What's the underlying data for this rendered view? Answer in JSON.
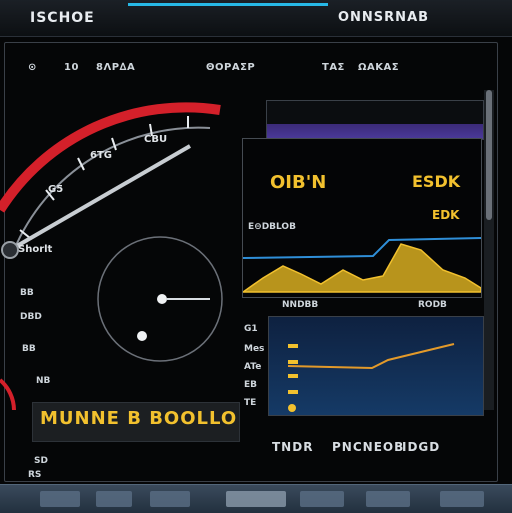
{
  "window": {
    "title": "ISCHOE",
    "title_right": "ONNSRNAB"
  },
  "header": {
    "items": [
      "⊙",
      "10 ",
      "8ΛΡ∆Α",
      "ΘΟΡΑΣΡ",
      "ΤΑΣ",
      "ΩΑΚΑΣ"
    ]
  },
  "speedometer": {
    "label_top": "CBU",
    "label_mid": "6TG",
    "label_left": "Shorlt",
    "label_lower": "G5",
    "side_labels": [
      "BB",
      "DBD",
      "BB",
      "NB",
      "SD",
      "RS"
    ]
  },
  "lcd": {
    "text": "MUNNE B BOOLLO"
  },
  "panels": {
    "top": {
      "big_left": "OIB'N",
      "big_right": "ESDK",
      "sub_right": "EDK",
      "label": "E⊖DBLOB"
    },
    "bottom": {
      "header_left": "NNDBB",
      "header_right": "RODB",
      "footer": [
        "TNDR",
        "PNCNEOB",
        "IDGD"
      ]
    },
    "side_labels": [
      "G1",
      "Mes",
      "ATe",
      "EB",
      "TE"
    ]
  },
  "taskbar": {
    "items": [
      "",
      "",
      "",
      "",
      "",
      "",
      ""
    ]
  },
  "colors": {
    "accent": "#27b8e6",
    "gauge_red": "#d4202a",
    "chart_yellow": "#f2c12e",
    "chart_blue": "#2f8fd8"
  }
}
